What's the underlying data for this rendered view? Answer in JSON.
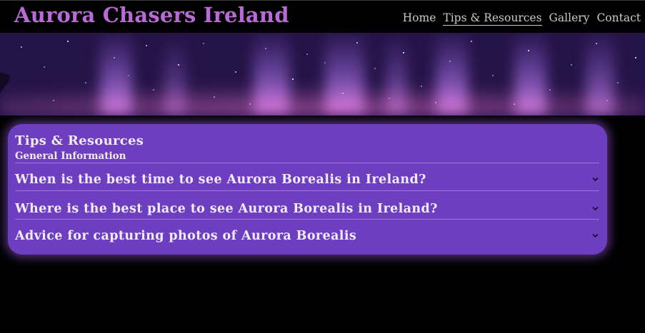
{
  "header": {
    "site_title": "Aurora Chasers Ireland",
    "nav": [
      {
        "label": "Home",
        "active": false
      },
      {
        "label": "Tips & Resources",
        "active": true
      },
      {
        "label": "Gallery",
        "active": false
      },
      {
        "label": "Contact",
        "active": false
      }
    ]
  },
  "colors": {
    "title": "#b96ad6",
    "panel": "#6e3ec0",
    "background": "#000000"
  },
  "panel": {
    "title": "Tips & Resources",
    "subtitle": "General Information",
    "items": [
      {
        "question": "When is the best time to see Aurora Borealis in Ireland?",
        "icon": "chevron-down-icon"
      },
      {
        "question": "Where is the best place to see Aurora Borealis in Ireland?",
        "icon": "chevron-down-icon"
      },
      {
        "question": "Advice for capturing photos of Aurora Borealis",
        "icon": "chevron-down-icon"
      }
    ]
  }
}
